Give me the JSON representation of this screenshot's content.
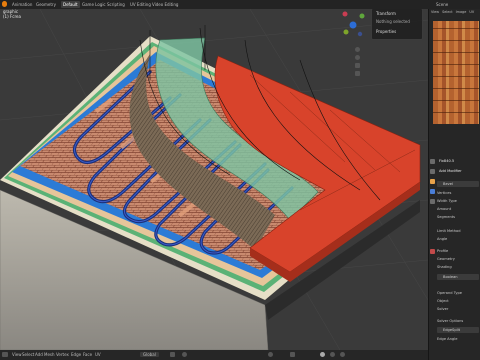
{
  "header": {
    "tabs": [
      "Animation",
      "Geometry",
      "Default",
      "Game Logic",
      "Scripting",
      "UV Editing",
      "Video Editing"
    ],
    "active_tab": "Default",
    "right_labels": [
      "Scene"
    ],
    "menu_right": [
      "View",
      "Select",
      "Image",
      "UV"
    ]
  },
  "viewport": {
    "overlay_text": "graphic",
    "overlay_text2": "(1) Fcrea",
    "n_panel": {
      "item_transform": "Transform",
      "note": "Nothing selected",
      "properties": "Properties"
    },
    "bottom_menu": [
      "View",
      "Select",
      "Add",
      "Mesh",
      "Vertex",
      "Edge",
      "Face",
      "UV"
    ],
    "shading_mode": "Global"
  },
  "properties": {
    "object_name": "Fix840.5",
    "modifier_add": "Add Modifier",
    "modifiers": [
      {
        "name": "Bevel",
        "fields": [
          "Vertices",
          "Width Type",
          "Amount",
          "Segments",
          "Limit Method",
          "Angle"
        ]
      },
      {
        "name": "Profile"
      },
      {
        "name": "Geometry"
      },
      {
        "name": "Shading"
      },
      {
        "name": "Boolean",
        "fields": [
          "Operand Type",
          "Object",
          "Solver"
        ]
      },
      {
        "name": "Solver Options"
      },
      {
        "name": "EdgeSplit",
        "fields": [
          "Edge Angle"
        ]
      }
    ]
  },
  "colors": {
    "red_layer": "#d8432b",
    "green_layer": "#7ec4a2",
    "heat_cable": "#1e3b8e",
    "brick_mesh": "#c97b63",
    "insulation_blue": "#2c7bd6"
  }
}
